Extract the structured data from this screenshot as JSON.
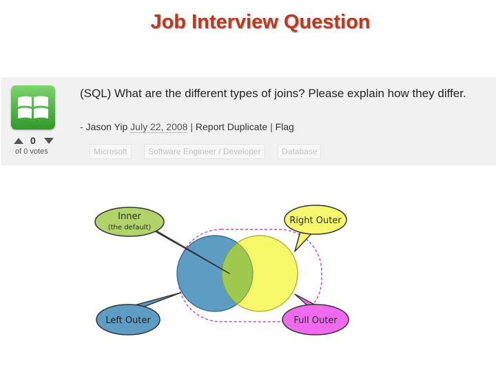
{
  "slide": {
    "title": "Job Interview Question"
  },
  "question": {
    "title": "(SQL) What are the different types of joins? Please explain how they differ.",
    "prefix": "- ",
    "author": "Jason Yip",
    "date": "July 22, 2008",
    "separator": "|",
    "report": "Report Duplicate",
    "flag": "Flag",
    "votes": {
      "count": "0",
      "label": "of 0 votes"
    },
    "tags": [
      "Microsoft",
      "Software Engineer / Developer",
      "Database"
    ]
  },
  "diagram": {
    "inner": "Inner",
    "inner_sub": "(the default)",
    "right_outer": "Right Outer",
    "left_outer": "Left Outer",
    "full_outer": "Full Outer",
    "colors": {
      "left_circle": "#5e9dc3",
      "right_circle": "#f7f76a",
      "overlap": "#9ec94e",
      "inner_bubble": "#b0d36a",
      "right_bubble": "#f8f86e",
      "left_bubble": "#5e9dc3",
      "full_bubble": "#f06af0",
      "dashed_outline": "#c44fc4"
    }
  }
}
